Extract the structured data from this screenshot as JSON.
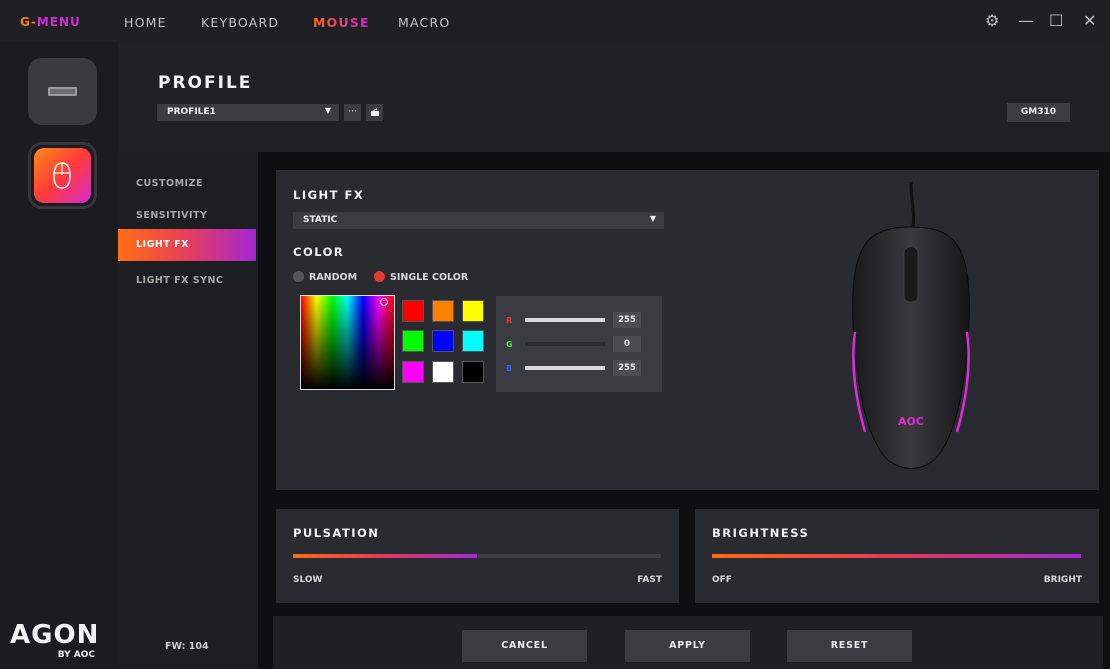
{
  "topbar": {
    "brand_left": "G-",
    "brand_right": "MENU",
    "tabs": [
      "HOME",
      "KEYBOARD",
      "MOUSE",
      "MACRO"
    ],
    "active_tab": "MOUSE"
  },
  "profile": {
    "title": "PROFILE",
    "selected": "PROFILE1",
    "more_label": "···",
    "model": "GM310"
  },
  "menu": {
    "items": [
      "CUSTOMIZE",
      "SENSITIVITY",
      "LIGHT FX",
      "LIGHT FX SYNC"
    ],
    "active": "LIGHT FX",
    "firmware": "FW: 104"
  },
  "lightfx": {
    "title": "LIGHT FX",
    "mode": "STATIC",
    "color_title": "COLOR",
    "radio_random": "RANDOM",
    "radio_single": "SINGLE COLOR",
    "selected_radio": "SINGLE COLOR",
    "swatches": [
      "#ff0000",
      "#ff8000",
      "#ffff00",
      "#00ff00",
      "#0000ff",
      "#00ffff",
      "#ff00ff",
      "#ffffff",
      "#000000"
    ],
    "rgb": {
      "r_label": "R",
      "r_value": "255",
      "r_level": 1.0,
      "g_label": "G",
      "g_value": "0",
      "g_level": 0.0,
      "b_label": "B",
      "b_value": "255",
      "b_level": 1.0
    },
    "mouse_logo": "AOC"
  },
  "pulsation": {
    "title": "PULSATION",
    "left": "SLOW",
    "right": "FAST",
    "level": 0.5
  },
  "brightness": {
    "title": "BRIGHTNESS",
    "left": "OFF",
    "right": "BRIGHT",
    "level": 1.0
  },
  "footer": {
    "cancel": "CANCEL",
    "apply": "APPLY",
    "reset": "RESET"
  },
  "logo": {
    "big": "AGON",
    "small": "BY AOC"
  },
  "colors": {
    "accent_orange": "#ff6a14",
    "accent_magenta": "#d21ed8",
    "selected_dot": "#e53935"
  }
}
